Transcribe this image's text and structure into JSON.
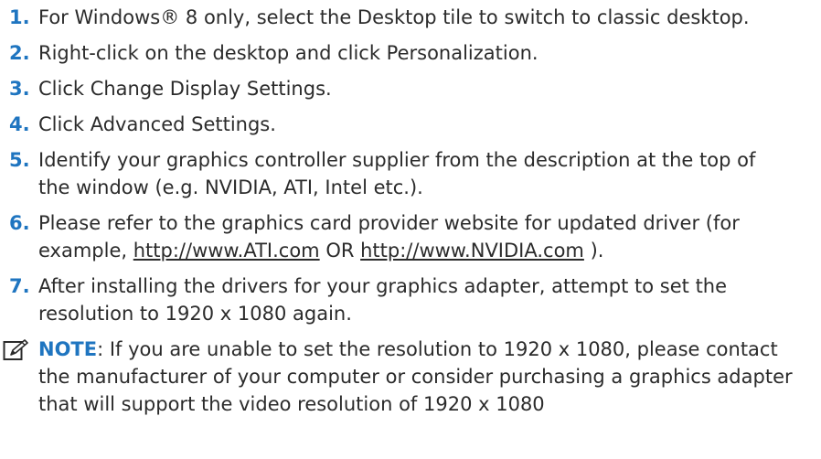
{
  "steps": [
    {
      "num": "1.",
      "text": "For Windows® 8 only, select the Desktop tile to switch to classic desktop."
    },
    {
      "num": "2.",
      "text": "Right-click on the desktop and click Personalization."
    },
    {
      "num": "3.",
      "text": "Click Change Display Settings."
    },
    {
      "num": "4.",
      "text": "Click Advanced Settings."
    },
    {
      "num": "5.",
      "text": "Identify your graphics controller supplier from the description at the top of the window (e.g. NVIDIA, ATI, Intel etc.)."
    },
    {
      "num": "6.",
      "text_before": "Please refer to the graphics card provider website for updated driver (for example, ",
      "link1": "http://www.ATI.com",
      "text_mid": " OR ",
      "link2": "http://www.NVIDIA.com",
      "text_after": " )."
    },
    {
      "num": "7.",
      "text": "After installing the drivers for your graphics adapter, attempt to set the resolution to 1920 x 1080 again."
    }
  ],
  "note": {
    "icon": "pencil-note-icon",
    "label": "NOTE",
    "text": ": If you are unable to set the resolution to 1920 x 1080, please contact the manufacturer of your computer or consider purchasing a graphics adapter that will support the video resolution of 1920 x 1080"
  },
  "colors": {
    "accent": "#1f75c0",
    "text": "#2b2b2b"
  }
}
